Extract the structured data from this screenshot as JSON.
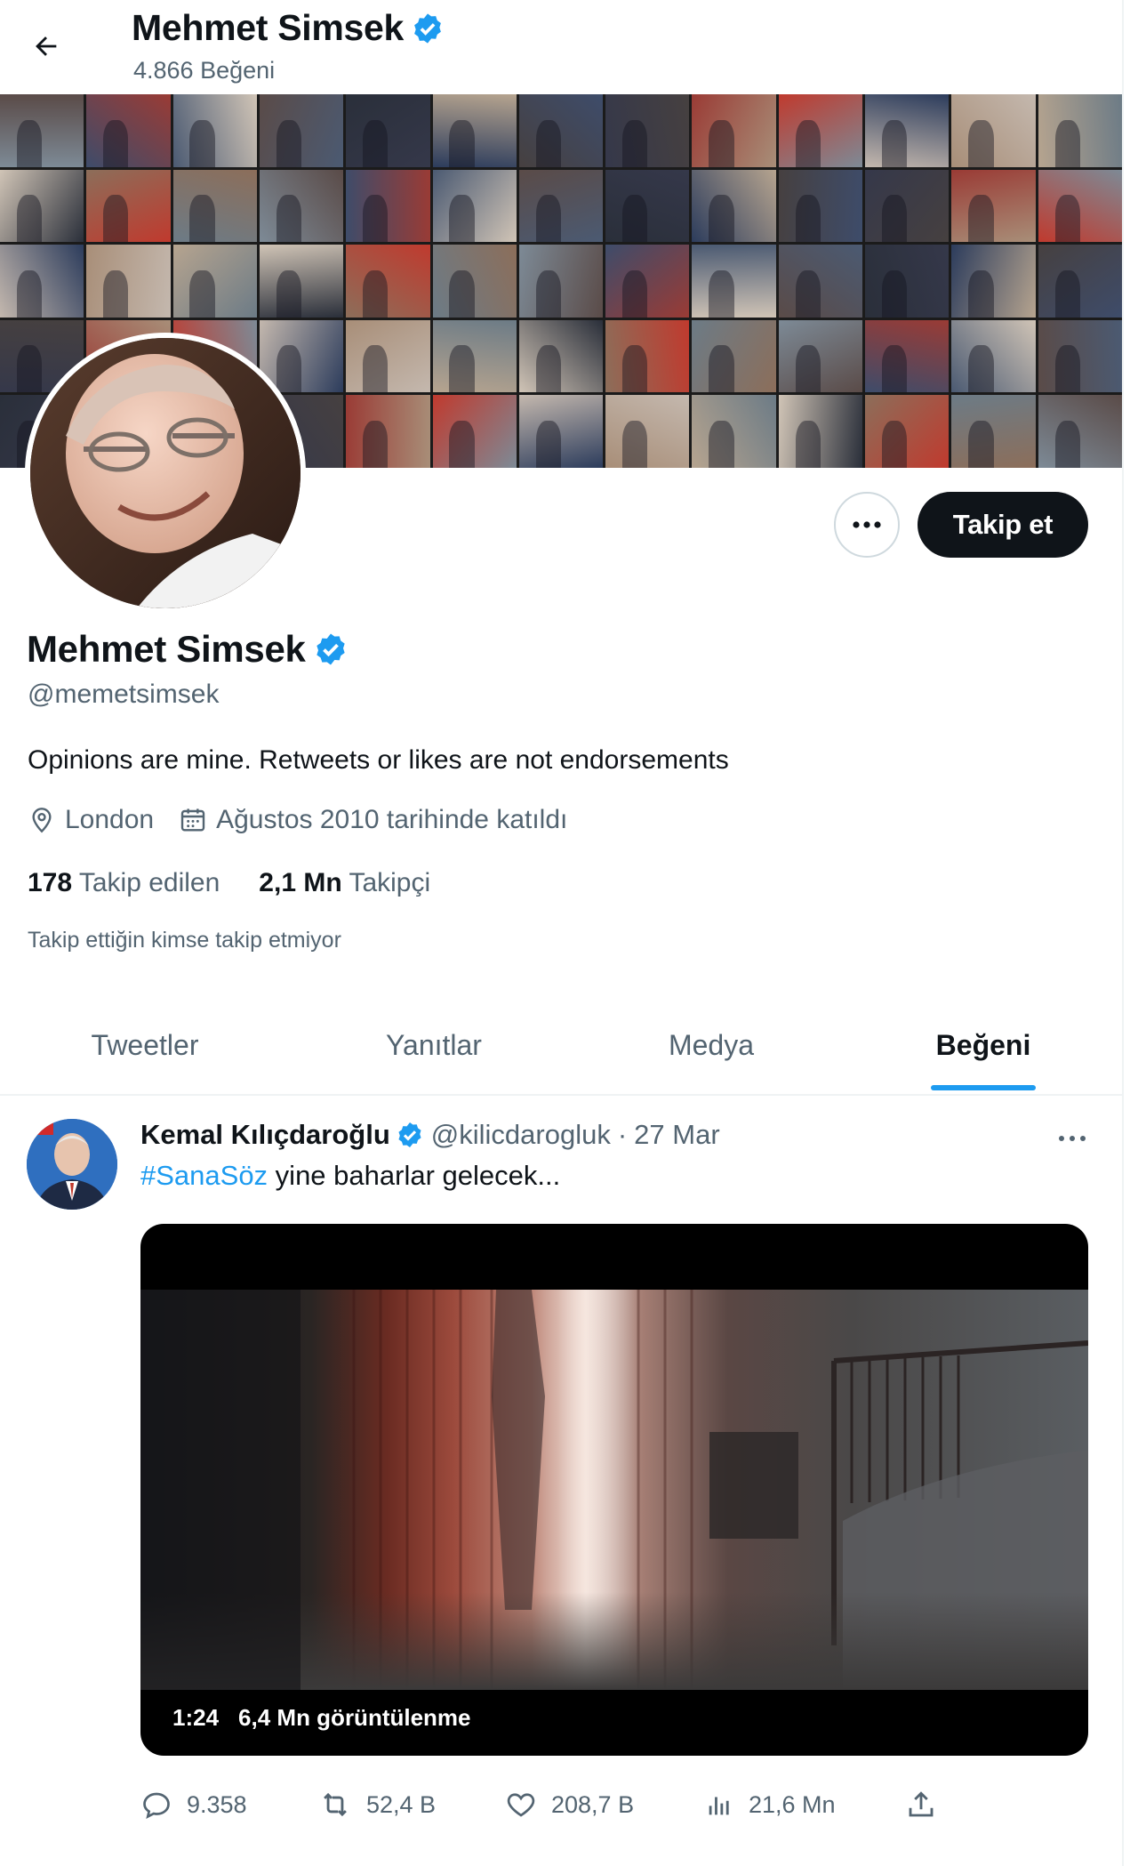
{
  "header": {
    "name": "Mehmet Simsek",
    "subtitle": "4.866 Beğeni"
  },
  "profile": {
    "name": "Mehmet Simsek",
    "handle": "@memetsimsek",
    "bio": "Opinions are mine. Retweets or likes are not endorsements",
    "location": "London",
    "joined": "Ağustos 2010 tarihinde katıldı",
    "following_count": "178",
    "following_label": "Takip edilen",
    "followers_count": "2,1 Mn",
    "followers_label": "Takipçi",
    "followed_by": "Takip ettiğin kimse takip etmiyor",
    "follow_label": "Takip et",
    "more_label": "···"
  },
  "tabs": [
    {
      "label": "Tweetler",
      "active": false
    },
    {
      "label": "Yanıtlar",
      "active": false
    },
    {
      "label": "Medya",
      "active": false
    },
    {
      "label": "Beğeni",
      "active": true
    }
  ],
  "tweet": {
    "display_name": "Kemal Kılıçdaroğlu",
    "handle": "@kilicdarogluk",
    "separator": "·",
    "date": "27 Mar",
    "hashtag": "#SanaSöz",
    "text": " yine baharlar gelecek...",
    "video_duration": "1:24",
    "video_views": "6,4 Mn görüntülenme",
    "replies": "9.358",
    "retweets": "52,4 B",
    "likes": "208,7 B",
    "views": "21,6 Mn"
  },
  "colors": {
    "accent": "#1d9bf0",
    "text": "#0f1419",
    "secondary": "#536471",
    "verified": "#1d9bf0",
    "follow_button": "#0f1419"
  },
  "icons": [
    "back-arrow-icon",
    "verified-badge-icon",
    "location-icon",
    "calendar-icon",
    "more-icon",
    "reply-icon",
    "retweet-icon",
    "like-icon",
    "views-icon",
    "share-icon"
  ]
}
